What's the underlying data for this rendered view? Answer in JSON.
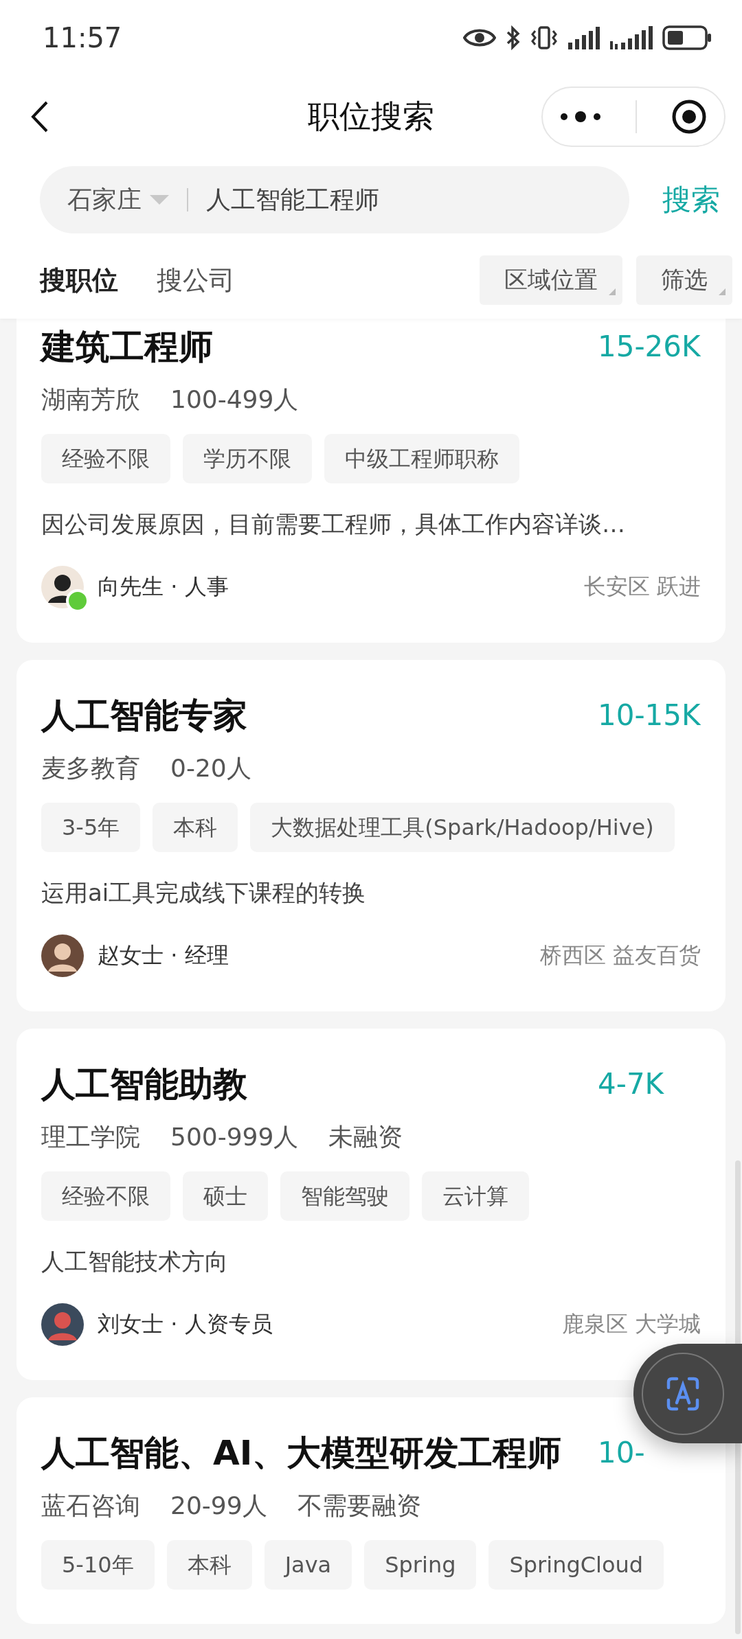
{
  "status_bar": {
    "time": "11:57"
  },
  "nav": {
    "title": "职位搜索"
  },
  "search": {
    "city": "石家庄",
    "query": "人工智能工程师",
    "button": "搜索"
  },
  "tabs": [
    {
      "label": "搜职位",
      "selected": true
    },
    {
      "label": "搜公司",
      "selected": false
    }
  ],
  "filters": [
    "区域位置",
    "筛选"
  ],
  "jobs": [
    {
      "title": "建筑工程师",
      "salary": "15-26K",
      "company_info": [
        "湖南芳欣",
        "100-499人"
      ],
      "tags": [
        "经验不限",
        "学历不限",
        "中级工程师职称"
      ],
      "description": "因公司发展原因，目前需要工程师，具体工作内容详谈…",
      "recruiter": {
        "name": "向先生 · 人事",
        "online": true
      },
      "location": "长安区 跃进"
    },
    {
      "title": "人工智能专家",
      "salary": "10-15K",
      "company_info": [
        "麦多教育",
        "0-20人"
      ],
      "tags": [
        "3-5年",
        "本科",
        "大数据处理工具(Spark/Hadoop/Hive)"
      ],
      "description": "运用ai工具完成线下课程的转换",
      "recruiter": {
        "name": "赵女士 · 经理",
        "online": false
      },
      "location": "桥西区 益友百货"
    },
    {
      "title": "人工智能助教",
      "salary": "4-7K",
      "company_info": [
        "理工学院",
        "500-999人",
        "未融资"
      ],
      "tags": [
        "经验不限",
        "硕士",
        "智能驾驶",
        "云计算"
      ],
      "description": "人工智能技术方向",
      "recruiter": {
        "name": "刘女士 · 人资专员",
        "online": false
      },
      "location": "鹿泉区 大学城"
    },
    {
      "title": "人工智能、AI、大模型研发工程师",
      "salary": "10-",
      "company_info": [
        "蓝石咨询",
        "20-99人",
        "不需要融资"
      ],
      "tags": [
        "5-10年",
        "本科",
        "Java",
        "Spring",
        "SpringCloud"
      ]
    }
  ]
}
